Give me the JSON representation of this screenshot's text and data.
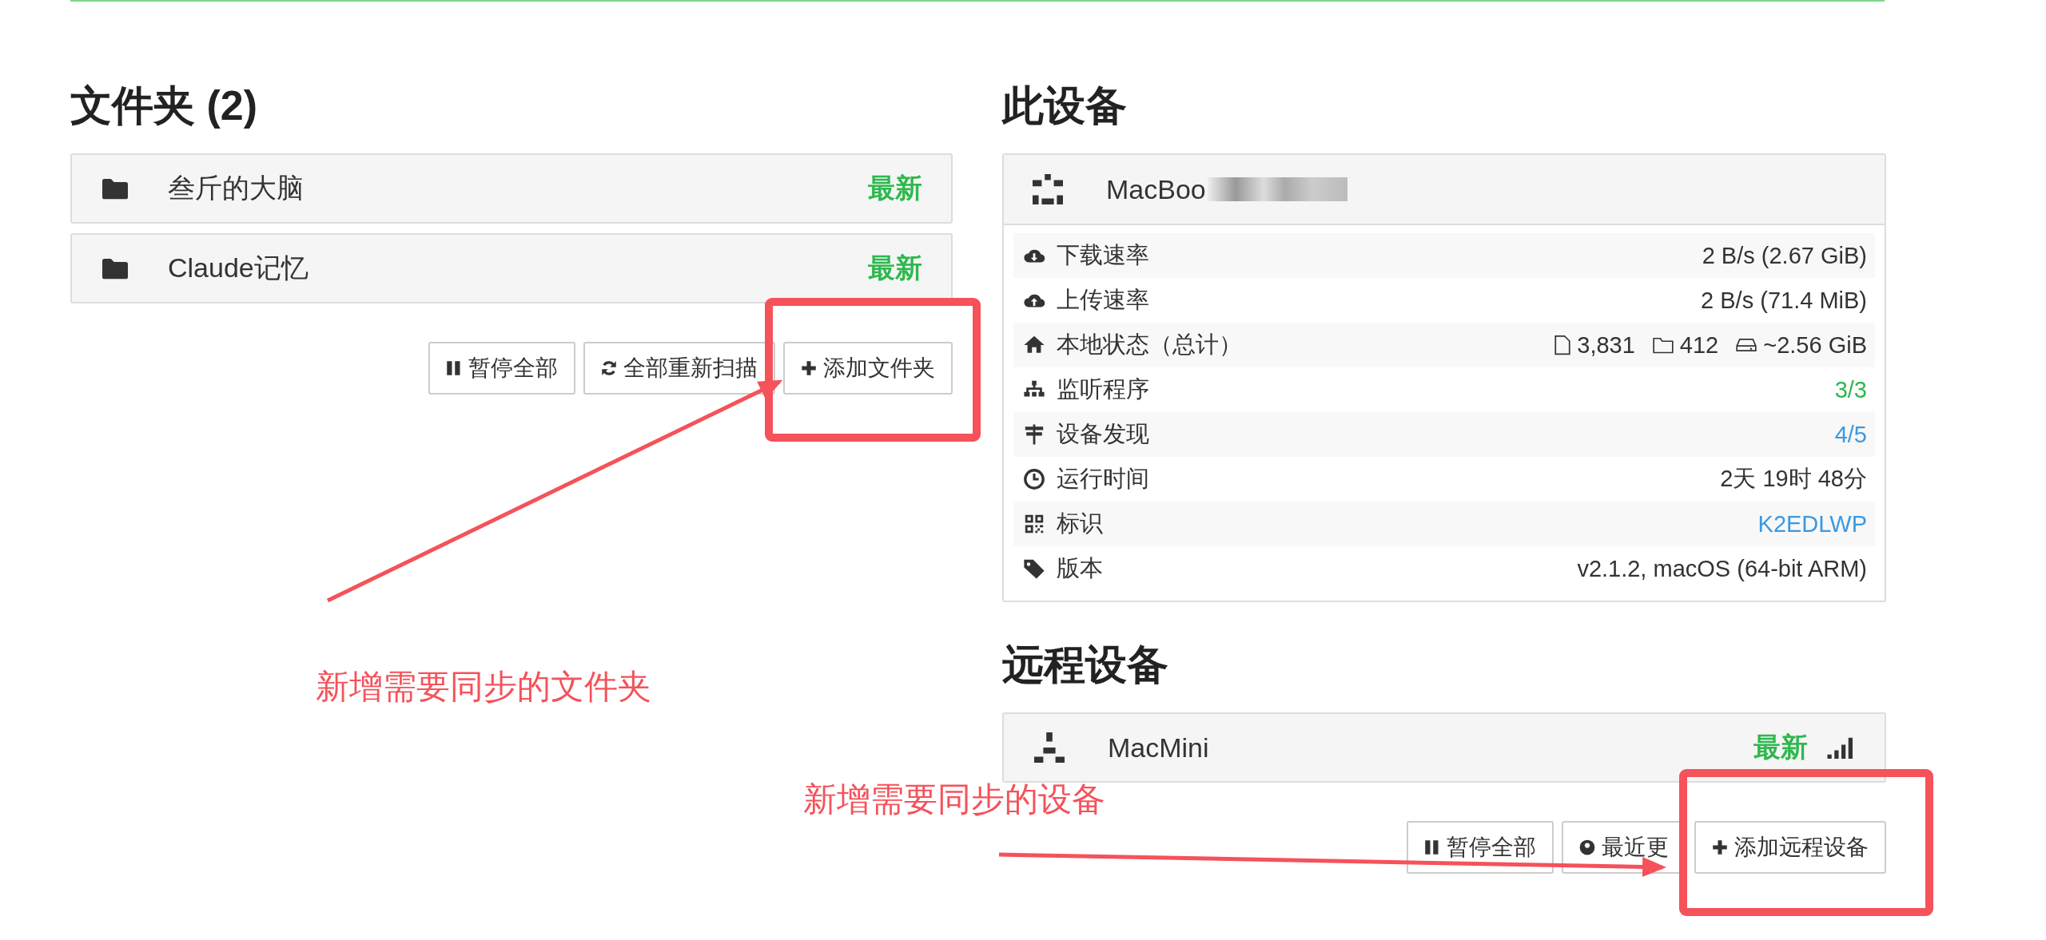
{
  "folders": {
    "title": "文件夹 (2)",
    "items": [
      {
        "name": "叁斤的大脑",
        "status": "最新"
      },
      {
        "name": "Claude记忆",
        "status": "最新"
      }
    ],
    "buttons": [
      {
        "label": "暂停全部"
      },
      {
        "label": "全部重新扫描"
      },
      {
        "label": "添加文件夹"
      }
    ]
  },
  "this_device": {
    "title": "此设备",
    "name": "MacBoo",
    "stats": [
      {
        "kind": "text",
        "label": "下载速率",
        "value": "2 B/s (2.67 GiB)",
        "color": "#333333"
      },
      {
        "kind": "text",
        "label": "上传速率",
        "value": "2 B/s (71.4 MiB)",
        "color": "#333333"
      },
      {
        "kind": "counts",
        "label": "本地状态（总计）",
        "files": "3,831",
        "dirs": "412",
        "size": "~2.56 GiB"
      },
      {
        "kind": "text",
        "label": "监听程序",
        "value": "3/3",
        "color": "#2db84d"
      },
      {
        "kind": "text",
        "label": "设备发现",
        "value": "4/5",
        "color": "#3b99e0"
      },
      {
        "kind": "text",
        "label": "运行时间",
        "value": "2天 19时 48分",
        "color": "#333333"
      },
      {
        "kind": "text",
        "label": "标识",
        "value": "K2EDLWP",
        "color": "#3b99e0"
      },
      {
        "kind": "text",
        "label": "版本",
        "value": "v2.1.2, macOS (64-bit ARM)",
        "color": "#333333"
      }
    ]
  },
  "remote_devices": {
    "title": "远程设备",
    "items": [
      {
        "name": "MacMini",
        "status": "最新"
      }
    ],
    "buttons": [
      {
        "label": "暂停全部"
      },
      {
        "label": "最近更"
      },
      {
        "label": "添加远程设备"
      }
    ]
  },
  "annotations": [
    {
      "text": "新增需要同步的文件夹"
    },
    {
      "text": "新增需要同步的设备"
    }
  ]
}
